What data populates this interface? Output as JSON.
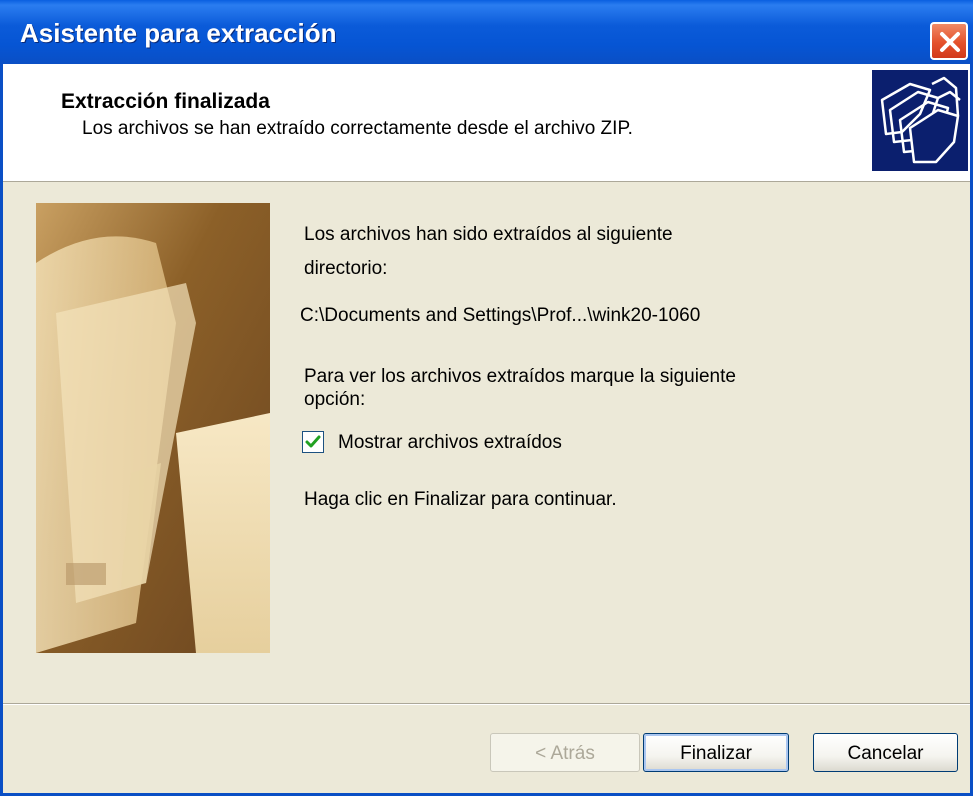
{
  "window": {
    "title": "Asistente para extracción"
  },
  "header": {
    "heading": "Extracción finalizada",
    "subheading": "Los archivos se han extraído correctamente desde el archivo ZIP.",
    "icon": "folders-icon"
  },
  "body": {
    "line1": "Los archivos han sido extraídos al siguiente",
    "line2": "directorio:",
    "path": "C:\\Documents and Settings\\Prof...\\wink20-1060",
    "option_line1": "Para ver los archivos extraídos marque la siguiente",
    "option_line2": "opción:",
    "checkbox_label": "Mostrar archivos extraídos",
    "checkbox_checked": true,
    "continue_text": "Haga clic en Finalizar para continuar."
  },
  "buttons": {
    "back": "< Atrás",
    "finish": "Finalizar",
    "cancel": "Cancelar"
  },
  "colors": {
    "titlebar": "#0a5fe0",
    "close": "#e4512b",
    "background": "#ece9d8",
    "check": "#21a121"
  }
}
